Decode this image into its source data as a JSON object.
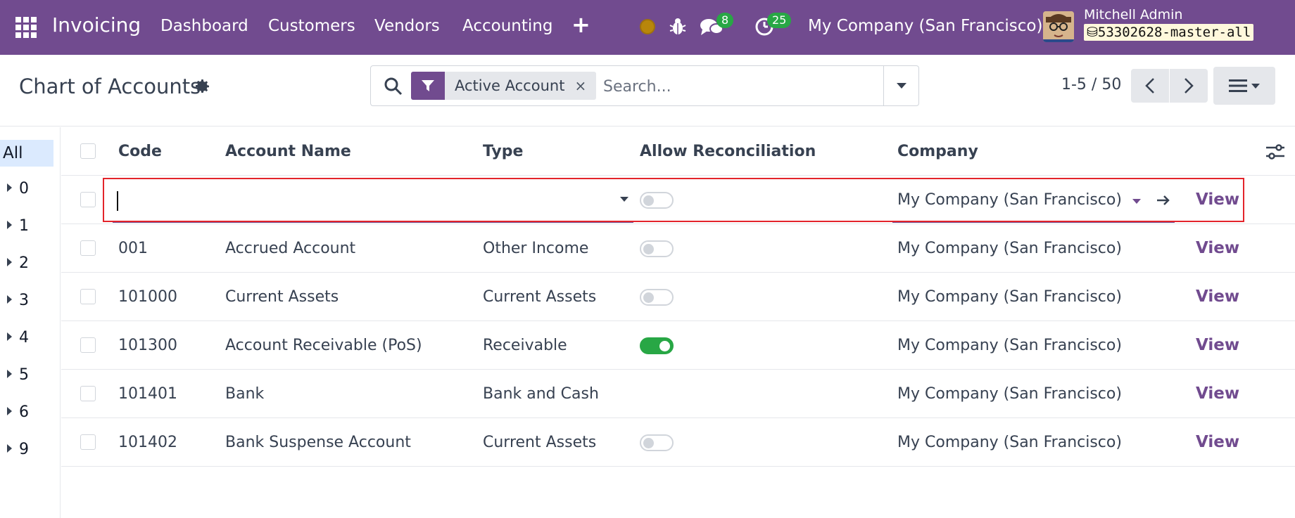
{
  "navbar": {
    "app_name": "Invoicing",
    "menu": [
      "Dashboard",
      "Customers",
      "Vendors",
      "Accounting"
    ],
    "messages_count": "8",
    "activities_count": "25",
    "company": "My Company (San Francisco)",
    "user_name": "Mitchell Admin",
    "db_name": "53302628-master-all"
  },
  "control_panel": {
    "title": "Chart of Accounts",
    "filter_label": "Active Account",
    "search_placeholder": "Search...",
    "pager": "1-5 / 50"
  },
  "sidebar": {
    "all_label": "All",
    "groups": [
      "0",
      "1",
      "2",
      "3",
      "4",
      "5",
      "6",
      "9"
    ]
  },
  "table": {
    "columns": {
      "code": "Code",
      "name": "Account Name",
      "type": "Type",
      "reconcile": "Allow Reconciliation",
      "company": "Company"
    },
    "new_row": {
      "company": "My Company (San Francisco)",
      "view_label": "View"
    },
    "rows": [
      {
        "code": "001",
        "name": "Accrued Account",
        "type": "Other Income",
        "reconcile": "off",
        "company": "My Company (San Francisco)",
        "view": "View"
      },
      {
        "code": "101000",
        "name": "Current Assets",
        "type": "Current Assets",
        "reconcile": "off",
        "company": "My Company (San Francisco)",
        "view": "View"
      },
      {
        "code": "101300",
        "name": "Account Receivable (PoS)",
        "type": "Receivable",
        "reconcile": "on",
        "company": "My Company (San Francisco)",
        "view": "View"
      },
      {
        "code": "101401",
        "name": "Bank",
        "type": "Bank and Cash",
        "reconcile": "none",
        "company": "My Company (San Francisco)",
        "view": "View"
      },
      {
        "code": "101402",
        "name": "Bank Suspense Account",
        "type": "Current Assets",
        "reconcile": "off",
        "company": "My Company (San Francisco)",
        "view": "View"
      }
    ]
  },
  "colors": {
    "brand": "#714B8F",
    "toggle_on": "#28a745",
    "highlight_border": "#e3242b"
  }
}
